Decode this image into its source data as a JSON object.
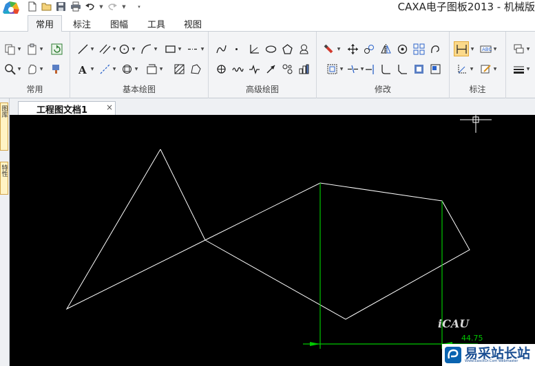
{
  "window": {
    "title": "CAXA电子图板2013 - 机械版",
    "logo_icon": "caxa-logo-icon"
  },
  "quick_access": [
    {
      "name": "new-file-icon"
    },
    {
      "name": "open-folder-icon"
    },
    {
      "name": "save-icon"
    },
    {
      "name": "print-icon"
    },
    {
      "name": "undo-icon"
    },
    {
      "name": "redo-icon"
    },
    {
      "name": "customize-qat-icon"
    }
  ],
  "tabs": [
    {
      "label": "常用",
      "active": true
    },
    {
      "label": "标注",
      "active": false
    },
    {
      "label": "图幅",
      "active": false
    },
    {
      "label": "工具",
      "active": false
    },
    {
      "label": "视图",
      "active": false
    }
  ],
  "ribbon_groups": [
    {
      "label": "常用"
    },
    {
      "label": "基本绘图"
    },
    {
      "label": "高级绘图"
    },
    {
      "label": "修改"
    },
    {
      "label": "标注"
    }
  ],
  "left_dock": {
    "tab1": "图库",
    "tab2": "特性"
  },
  "document_tab": {
    "label": "工程图文档1",
    "close": "×"
  },
  "canvas": {
    "background": "#000000",
    "line_color": "#ffffff",
    "dim_color": "#00c800",
    "dimension_text": "44.75",
    "stamp_text": "iCAU"
  },
  "watermark": {
    "text": "易采站长站",
    "sub": "Www.EasckOr.Com Webmaster"
  },
  "colors": {
    "accent_tab_border": "#c8cdd4",
    "dimension_green": "#00c800",
    "active_dim_button": "#fbd98a"
  }
}
